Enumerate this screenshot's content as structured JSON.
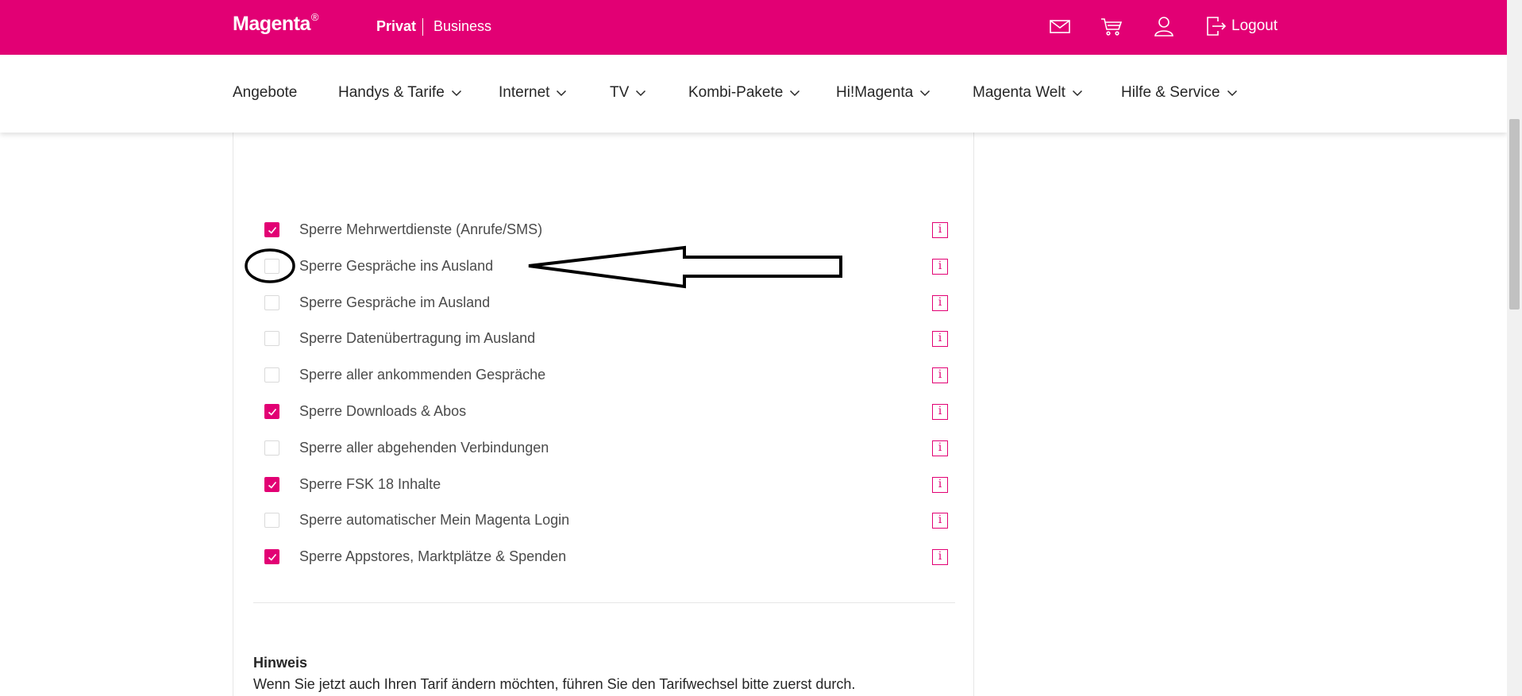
{
  "colors": {
    "brand": "#e20074",
    "text": "#262626",
    "muted_text": "#4b4b4b",
    "border": "#e6e6e6"
  },
  "header": {
    "brand_name": "Magenta",
    "brand_mark": "®",
    "segments": [
      "Privat",
      "Business"
    ],
    "active_segment": "Privat",
    "icons": [
      "mail-icon",
      "cart-icon",
      "user-icon",
      "logout-icon"
    ],
    "logout_label": "Logout"
  },
  "nav": {
    "items": [
      {
        "label": "Angebote",
        "has_dropdown": false
      },
      {
        "label": "Handys & Tarife",
        "has_dropdown": true
      },
      {
        "label": "Internet",
        "has_dropdown": true
      },
      {
        "label": "TV",
        "has_dropdown": true
      },
      {
        "label": "Kombi-Pakete",
        "has_dropdown": true
      },
      {
        "label": "Hi!Magenta",
        "has_dropdown": true
      },
      {
        "label": "Magenta Welt",
        "has_dropdown": true
      },
      {
        "label": "Hilfe & Service",
        "has_dropdown": true
      }
    ]
  },
  "options": [
    {
      "label": "Sperre Mehrwertdienste (Anrufe/SMS)",
      "checked": true
    },
    {
      "label": "Sperre Gespräche ins Ausland",
      "checked": false
    },
    {
      "label": "Sperre Gespräche im Ausland",
      "checked": false
    },
    {
      "label": "Sperre Datenübertragung im Ausland",
      "checked": false
    },
    {
      "label": "Sperre aller ankommenden Gespräche",
      "checked": false
    },
    {
      "label": "Sperre Downloads & Abos",
      "checked": true
    },
    {
      "label": "Sperre aller abgehenden Verbindungen",
      "checked": false
    },
    {
      "label": "Sperre FSK 18 Inhalte",
      "checked": true
    },
    {
      "label": "Sperre automatischer Mein Magenta Login",
      "checked": false
    },
    {
      "label": "Sperre Appstores, Marktplätze & Spenden",
      "checked": true
    }
  ],
  "info_icon_glyph": "i",
  "hinweis": {
    "title": "Hinweis",
    "text": "Wenn Sie jetzt auch Ihren Tarif ändern möchten, führen Sie den Tarifwechsel bitte zuerst durch."
  }
}
